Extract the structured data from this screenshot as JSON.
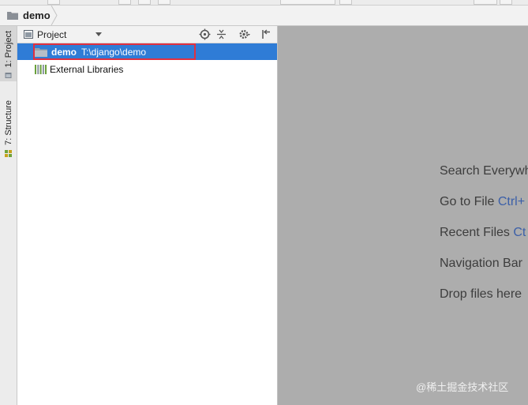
{
  "breadcrumb": {
    "project": "demo"
  },
  "left_strip": {
    "project_tab": "1: Project",
    "structure_tab": "7: Structure"
  },
  "project_panel": {
    "view_label": "Project",
    "toolbar_icons": [
      "locate-icon",
      "collapse-all-icon",
      "gear-icon",
      "hide-panel-icon"
    ],
    "tree": {
      "root": {
        "name": "demo",
        "path": "T:\\django\\demo",
        "selected": true
      },
      "external": {
        "label": "External Libraries"
      }
    }
  },
  "editor_hints": [
    {
      "text": "Search Everywh",
      "key": ""
    },
    {
      "text": "Go to File ",
      "key": "Ctrl+"
    },
    {
      "text": "Recent Files ",
      "key": "Ct"
    },
    {
      "text": "Navigation Bar",
      "key": ""
    },
    {
      "text": "Drop files here",
      "key": ""
    }
  ],
  "watermark": "@稀土掘金技术社区",
  "colors": {
    "selection": "#2f7cd6",
    "highlight_box": "#e03040",
    "editor_bg": "#adadad",
    "shortcut": "#3b5fa8"
  }
}
